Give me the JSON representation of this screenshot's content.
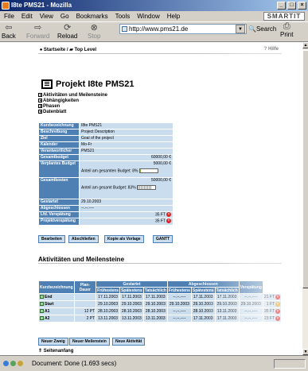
{
  "window": {
    "title": "I8te PMS21 - Mozilla"
  },
  "menu": [
    "File",
    "Edit",
    "View",
    "Go",
    "Bookmarks",
    "Tools",
    "Window",
    "Help"
  ],
  "brand": "SMARTIT",
  "toolbar": {
    "back": "Back",
    "forward": "Forward",
    "reload": "Reload",
    "stop": "Stop",
    "url": "http://www.pms21.de",
    "search": "Search",
    "print": "Print"
  },
  "breadcrumb": {
    "start": "Startseite",
    "sep": "/",
    "top": "Top Level",
    "help": "? Hilfe"
  },
  "project": {
    "title": "Projekt I8te PMS21",
    "sections": [
      "Aktivitäten und Meilensteine",
      "Abhängigkeiten",
      "Phasen",
      "Datenblatt"
    ]
  },
  "info": [
    {
      "k": "Kurzbezeichnung",
      "v": "I8te PMS21"
    },
    {
      "k": "Beschreibung",
      "v": "Project Description"
    },
    {
      "k": "Ziel",
      "v": "Goal of the project"
    },
    {
      "k": "Kalender",
      "v": "Mo-Fr"
    },
    {
      "k": "Verantwortlicher",
      "v": "PMS21"
    },
    {
      "k": "Gesamtbudget",
      "v": "60000,00 €"
    }
  ],
  "budget": {
    "verplantes_label": "Verplantes Budget",
    "verplantes_value": "5000,00 €",
    "verplantes_note": "Anteil am gesamten Budget: 8%",
    "verplantes_pct": 0.08,
    "kosten_label": "Gesamtkosten",
    "kosten_value": "50000,00 €",
    "kosten_note": "Anteil am gesamt Budget: 83%",
    "kosten_pct": 0.83
  },
  "info2": [
    {
      "k": "Gestartet",
      "v": "29.10.2003"
    },
    {
      "k": "Abgeschlossen",
      "v": "--.--.----"
    },
    {
      "k": "Lfd. Verspätung",
      "v": "35 FT"
    },
    {
      "k": "Projektverspätung",
      "v": "35 FT"
    }
  ],
  "buttons": [
    "Bearbeiten",
    "Abschließen",
    "Kopie als Vorlage",
    "GANTT"
  ],
  "activities": {
    "title": "Aktivitäten und Meilensteine",
    "headers": {
      "name": "Kurzbezeichnung",
      "plan": "Plan-Dauer",
      "gestartet": "Gestartet",
      "abgeschlossen": "Abgeschlossen",
      "verspaetung": "Verspätung",
      "sub": [
        "Frühestens",
        "Spätestens",
        "Tatsächlich",
        "Frühestens",
        "Spätestens",
        "Tatsächlich"
      ]
    },
    "rows": [
      {
        "name": "End",
        "plan": "",
        "c": [
          "17.11.2003",
          "17.11.2003",
          "17.11.2003",
          "--.--.----",
          "17.11.2003",
          "17.11.2003",
          "--.--.----"
        ],
        "v": "21 FT"
      },
      {
        "name": "Start",
        "plan": "",
        "c": [
          "29.10.2003",
          "29.10.2003",
          "29.10.2003",
          "29.10.2003",
          "29.10.2003",
          "29.10.2003",
          "29.10.2003"
        ],
        "v": "1 FT"
      },
      {
        "name": "A1",
        "plan": "12 PT",
        "c": [
          "28.10.2003",
          "28.10.2003",
          "28.10.2003",
          "--.--.----",
          "28.10.2003",
          "13.11.2003",
          "--.--.----"
        ],
        "v": "35 FT"
      },
      {
        "name": "A2",
        "plan": "2 PT",
        "c": [
          "13.11.2003",
          "13.11.2003",
          "13.11.2003",
          "--.--.----",
          "17.11.2003",
          "17.11.2003",
          "--.--.----"
        ],
        "v": "23 FT"
      }
    ]
  },
  "bottom_buttons": [
    "Neuer Zweig",
    "Neuer Meilenstein",
    "Neue Aktivität"
  ],
  "seitenanfang": "Seitenanfang",
  "status": "Document: Done (1.693 secs)"
}
